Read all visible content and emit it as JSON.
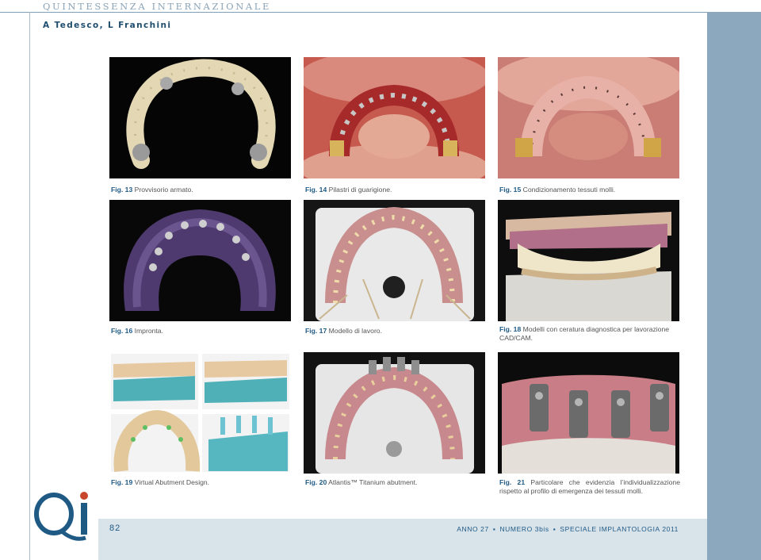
{
  "header": {
    "journal": "QUINTESSENZA INTERNAZIONALE",
    "authors": "A Tedesco, L Franchini"
  },
  "figures": [
    {
      "num": "Fig. 13",
      "caption": "Provvisorio armato."
    },
    {
      "num": "Fig. 14",
      "caption": "Pilastri di guarigione."
    },
    {
      "num": "Fig. 15",
      "caption": "Condizionamento tessuti molli."
    },
    {
      "num": "Fig. 16",
      "caption": "Impronta."
    },
    {
      "num": "Fig. 17",
      "caption": "Modello di lavoro."
    },
    {
      "num": "Fig. 18",
      "caption": "Modelli con ceratura diagnostica per lavorazione CAD/CAM."
    },
    {
      "num": "Fig. 19",
      "caption": "Virtual Abutment Design."
    },
    {
      "num": "Fig. 20",
      "caption": "Atlantis™ Titanium abutment."
    },
    {
      "num": "Fig. 21",
      "caption": "Particolare che evidenzia l’individualizzazione rispetto al profilo di emergenza dei tessuti molli."
    }
  ],
  "footer": {
    "page_number": "82",
    "anno": "ANNO 27",
    "numero": "NUMERO 3bis",
    "speciale": "SPECIALE IMPLANTOLOGIA 2011",
    "separator": "▪"
  },
  "logo": {
    "text": "QI"
  },
  "colors": {
    "brand_blue": "#1f5a85",
    "side_band": "#8ba8be",
    "footer_band": "#d9e3ea"
  }
}
